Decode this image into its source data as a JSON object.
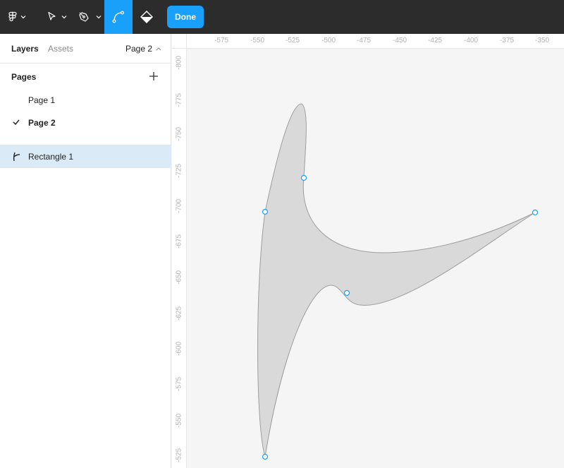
{
  "toolbar": {
    "tools": [
      {
        "name": "figma-menu",
        "icon": "figma-logo-icon",
        "has_dropdown": true
      },
      {
        "name": "move-tool",
        "icon": "cursor-arrow-icon",
        "has_dropdown": true
      },
      {
        "name": "pen-tool",
        "icon": "pen-nib-icon",
        "has_dropdown": true
      },
      {
        "name": "bend-tool",
        "icon": "bend-path-icon",
        "active": true
      },
      {
        "name": "paint-bucket-tool",
        "icon": "paint-bucket-icon"
      }
    ],
    "done_label": "Done",
    "accent_color": "#18a0fb"
  },
  "left_panel": {
    "tabs": {
      "layers": "Layers",
      "assets": "Assets"
    },
    "current_page": "Page 2",
    "pages_header": "Pages",
    "pages": [
      {
        "label": "Page 1",
        "selected": false
      },
      {
        "label": "Page 2",
        "selected": true
      }
    ],
    "layers": [
      {
        "label": "Rectangle 1",
        "icon": "vector-path-icon",
        "selected": true
      }
    ]
  },
  "rulers": {
    "x_labels": [
      "-575",
      "-550",
      "-525",
      "-500",
      "-475",
      "-450",
      "-425",
      "-400",
      "-375",
      "-350"
    ],
    "y_labels": [
      "-800",
      "-775",
      "-750",
      "-725",
      "-700",
      "-675",
      "-650",
      "-625",
      "-600",
      "-575",
      "-550",
      "-525"
    ]
  },
  "shape": {
    "name": "Rectangle 1",
    "fill": "#d9d9d9",
    "stroke": "#9e9e9e",
    "anchor_color": "#18a0fb"
  }
}
